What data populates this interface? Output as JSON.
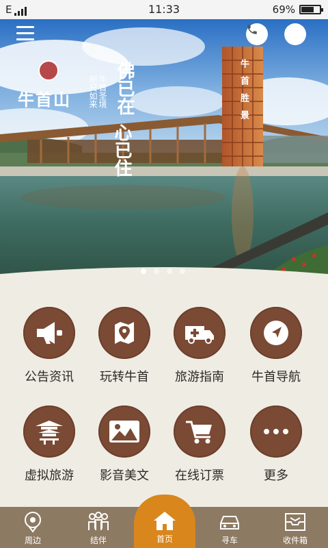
{
  "status_bar": {
    "network": "E",
    "time": "11:33",
    "battery": "69%",
    "battery_level": 0.69
  },
  "banner": {
    "logo_text": "牛首山",
    "calligraphy_line1": "佛",
    "calligraphy_line2": "已在",
    "calligraphy_line3": "心已住",
    "sub_text_1": "牛首圣境",
    "sub_text_2": "咫尺如来",
    "tower_text": "牛首胜景",
    "slide_count": 4,
    "active_slide": 1
  },
  "grid": {
    "items": [
      {
        "label": "公告资讯",
        "icon": "megaphone-icon"
      },
      {
        "label": "玩转牛首",
        "icon": "map-pin-icon"
      },
      {
        "label": "旅游指南",
        "icon": "ambulance-icon"
      },
      {
        "label": "牛首导航",
        "icon": "navigation-arrow-icon"
      },
      {
        "label": "虚拟旅游",
        "icon": "pagoda-icon"
      },
      {
        "label": "影音美文",
        "icon": "landscape-picture-icon"
      },
      {
        "label": "在线订票",
        "icon": "shopping-cart-icon"
      },
      {
        "label": "更多",
        "icon": "more-dots-icon"
      }
    ]
  },
  "bottom_nav": {
    "items": [
      {
        "label": "周边",
        "icon": "location-pin-icon"
      },
      {
        "label": "结伴",
        "icon": "group-icon"
      },
      {
        "label": "首页",
        "icon": "home-icon"
      },
      {
        "label": "寻车",
        "icon": "car-icon"
      },
      {
        "label": "收件箱",
        "icon": "inbox-icon"
      }
    ]
  },
  "colors": {
    "icon_circle": "#7a4a35",
    "nav_bar": "#8d7a63",
    "nav_home_active": "#d9861c",
    "background": "#efece3"
  }
}
